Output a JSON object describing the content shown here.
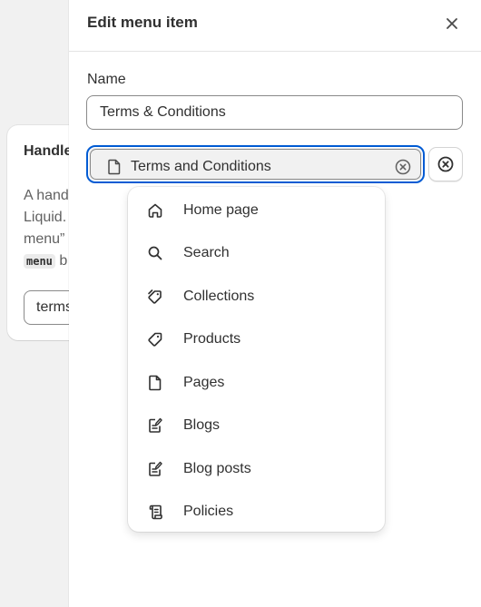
{
  "background_card": {
    "title": "Handle",
    "description_lines": [
      "A hand",
      "Liquid.",
      "menu”",
      "b"
    ],
    "code": "menu",
    "handle_value": "terms"
  },
  "drawer": {
    "title": "Edit menu item",
    "name_label": "Name",
    "name_value": "Terms & Conditions",
    "link_value": "Terms and Conditions",
    "link_icon": "page-icon",
    "clear_icon": "circle-x-icon",
    "remove_icon": "circle-x-bold-icon"
  },
  "dropdown": {
    "items": [
      {
        "label": "Home page",
        "icon": "home-icon"
      },
      {
        "label": "Search",
        "icon": "search-icon"
      },
      {
        "label": "Collections",
        "icon": "collections-icon"
      },
      {
        "label": "Products",
        "icon": "tag-icon"
      },
      {
        "label": "Pages",
        "icon": "page-icon"
      },
      {
        "label": "Blogs",
        "icon": "blog-icon"
      },
      {
        "label": "Blog posts",
        "icon": "blog-post-icon"
      },
      {
        "label": "Policies",
        "icon": "policy-icon"
      }
    ]
  },
  "colors": {
    "focus_ring": "#005bd3",
    "text": "#303030",
    "muted_text": "#616161",
    "border": "#8a8a8a"
  }
}
